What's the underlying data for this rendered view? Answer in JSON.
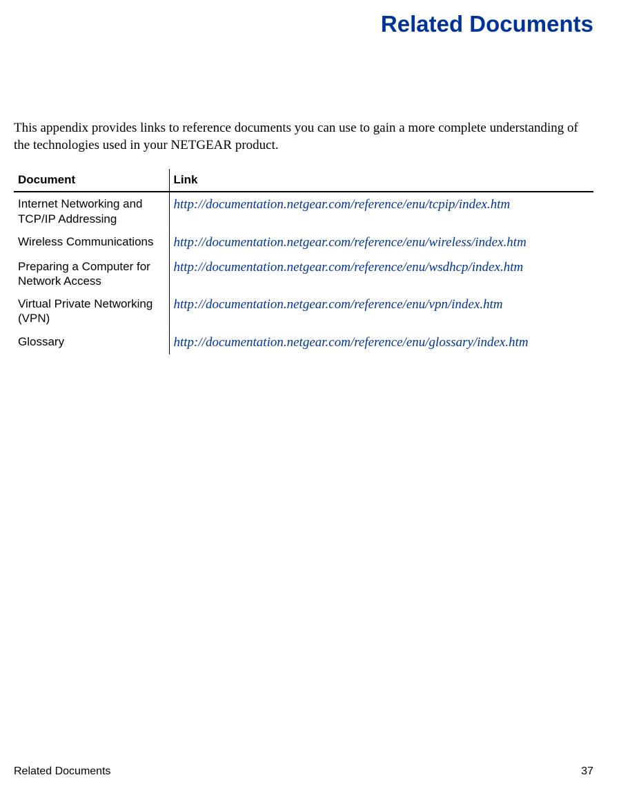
{
  "title": "Related Documents",
  "intro": "This appendix provides links to reference documents you can use to gain a more complete understanding of the technologies used in your NETGEAR product.",
  "table": {
    "headers": {
      "document": "Document",
      "link": "Link"
    },
    "rows": [
      {
        "document": "Internet Networking and TCP/IP Addressing",
        "link": "http://documentation.netgear.com/reference/enu/tcpip/index.htm"
      },
      {
        "document": "Wireless Communications",
        "link": "http://documentation.netgear.com/reference/enu/wireless/index.htm"
      },
      {
        "document": "Preparing a Computer for Network Access",
        "link": "http://documentation.netgear.com/reference/enu/wsdhcp/index.htm"
      },
      {
        "document": "Virtual Private Networking (VPN)",
        "link": "http://documentation.netgear.com/reference/enu/vpn/index.htm"
      },
      {
        "document": "Glossary",
        "link": "http://documentation.netgear.com/reference/enu/glossary/index.htm"
      }
    ]
  },
  "footer": {
    "left": "Related Documents",
    "right": "37"
  }
}
